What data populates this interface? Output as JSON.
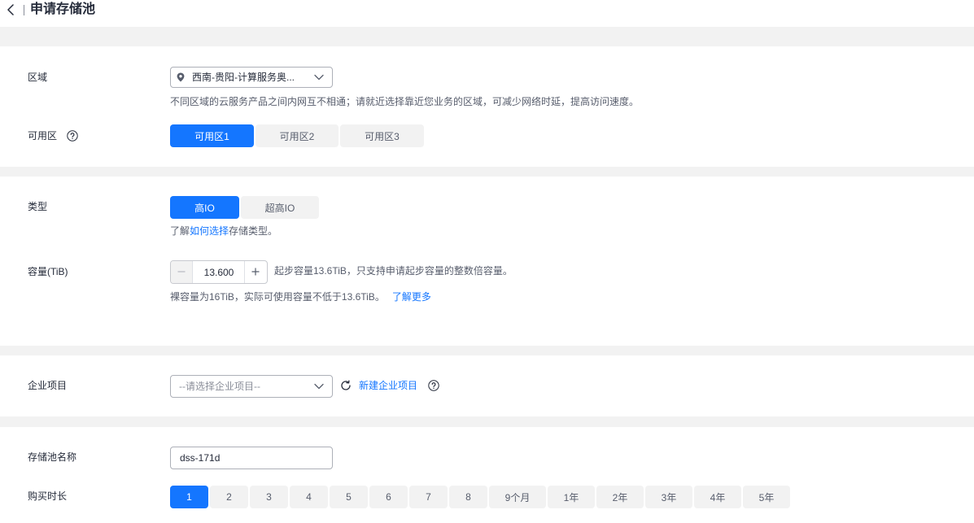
{
  "header": {
    "back_icon": "chevron-left-icon",
    "title": "申请存储池"
  },
  "region": {
    "label": "区域",
    "icon": "location-pin-icon",
    "value": "西南-贵阳-计算服务奥...",
    "dropdown_icon": "chevron-down-icon",
    "hint": "不同区域的云服务产品之间内网互不相通；请就近选择靠近您业务的区域，可减少网络时延，提高访问速度。"
  },
  "az": {
    "label": "可用区",
    "help_icon": "help-icon",
    "options": [
      "可用区1",
      "可用区2",
      "可用区3"
    ],
    "selected": "可用区1"
  },
  "type": {
    "label": "类型",
    "options": [
      "高IO",
      "超高IO"
    ],
    "selected": "高IO",
    "learn_prefix": "了解",
    "learn_link": "如何选择",
    "learn_suffix": "存储类型。"
  },
  "capacity": {
    "label": "容量(TiB)",
    "value": "13.600",
    "decrement_icon": "minus-icon",
    "increment_icon": "plus-icon",
    "decrement_disabled": true,
    "note": "起步容量13.6TiB，只支持申请起步容量的整数倍容量。",
    "raw_note": "裸容量为16TiB，实际可使用容量不低于13.6TiB。",
    "learn_more": "了解更多"
  },
  "enterprise_project": {
    "label": "企业项目",
    "placeholder": "--请选择企业项目--",
    "dropdown_icon": "chevron-down-icon",
    "refresh_icon": "refresh-icon",
    "create_link": "新建企业项目",
    "help_icon": "help-icon"
  },
  "pool_name": {
    "label": "存储池名称",
    "value": "dss-171d"
  },
  "duration": {
    "label": "购买时长",
    "options": [
      "1",
      "2",
      "3",
      "4",
      "5",
      "6",
      "7",
      "8",
      "9个月",
      "1年",
      "2年",
      "3年",
      "4年",
      "5年"
    ],
    "selected": "1"
  },
  "colors": {
    "accent": "#1476ff",
    "link": "#1476ff",
    "page_background": "#f2f2f2",
    "text": "#252b3a",
    "hint_text": "#575d6c"
  }
}
